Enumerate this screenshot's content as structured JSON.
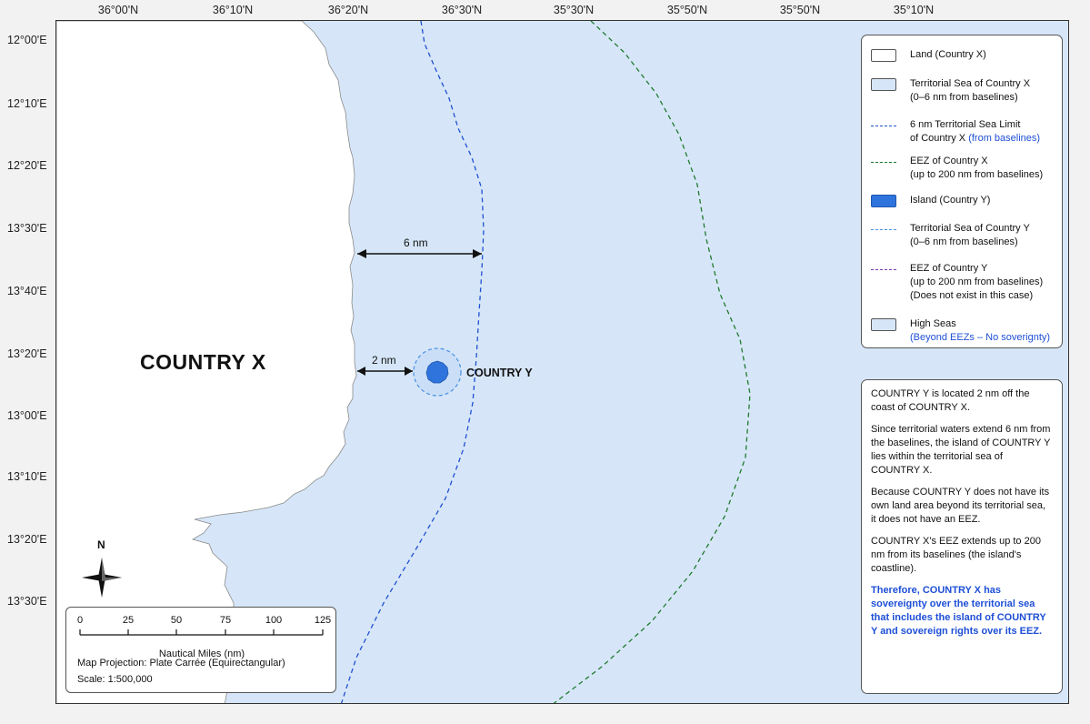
{
  "axes": {
    "top_labels": [
      "36°00'N",
      "36°10'N",
      "36°20'N",
      "36°30'N",
      "35°30'N",
      "35°50'N",
      "35°50'N",
      "35°10'N"
    ],
    "left_labels": [
      "12°00'E",
      "12°10'E",
      "12°20'E",
      "13°30'E",
      "13°40'E",
      "13°20'E",
      "13°00'E",
      "13°10'E",
      "13°20'E",
      "13°30'E"
    ]
  },
  "map": {
    "country_x_label": "COUNTRY X",
    "country_y_label": "COUNTRY Y",
    "six_nm_label": "6 nm",
    "two_nm_label": "2 nm",
    "north_label": "N"
  },
  "legend": {
    "items": [
      {
        "lines": [
          "Land (Country X)"
        ],
        "swatch": "land"
      },
      {
        "lines": [
          "Territorial Sea of Country X",
          "(0–6 nm from baselines)"
        ],
        "swatch": "sea"
      },
      {
        "lines": [
          "6 nm Territorial Sea Limit",
          "of Country X"
        ],
        "extra": "(from baselines)",
        "swatch": "dash-blue"
      },
      {
        "lines": [
          "EEZ of Country X",
          "(up to 200 nm from baselines)"
        ],
        "swatch": "dash-green"
      },
      {
        "lines": [
          "Island (Country Y)"
        ],
        "swatch": "island"
      },
      {
        "lines": [
          "Territorial Sea of Country Y",
          "(0–6 nm from baselines)"
        ],
        "swatch": "dash-lightblue"
      },
      {
        "lines": [
          "EEZ of Country Y",
          "(up to 200 nm from baselines)",
          "(Does not exist in this case)"
        ],
        "swatch": "dash-purple"
      },
      {
        "lines": [
          "High Seas"
        ],
        "extra_line": "(Beyond EEZs – No soverignty)",
        "swatch": "sea"
      }
    ]
  },
  "notes": {
    "p1": "COUNTRY Y is located 2 nm off the coast of COUNTRY X.",
    "p2": "Since territorial waters extend 6 nm from the baselines, the island of COUNTRY Y lies within the territorial sea of COUNTRY X.",
    "p3": "Because COUNTRY Y does not have its own land area beyond its territorial sea, it does not have an EEZ.",
    "p4": "COUNTRY X's EEZ extends up to 200 nm from its baselines (the island's coastline).",
    "p5": "Therefore, COUNTRY X has sovereignty over the territorial sea that includes the island of COUNTRY Y and sovereign rights over its EEZ."
  },
  "scale": {
    "ticks": [
      "0",
      "25",
      "50",
      "75",
      "100",
      "125"
    ],
    "title": "Nautical Miles (nm)",
    "projection": "Map Projection: Plate Carrée (Equirectangular)",
    "scale_text": "Scale: 1:500,000"
  },
  "colors": {
    "land": "#ffffff",
    "sea": "#d6e6f8",
    "limit_6nm": "#1f4fd1",
    "eez_x": "#1f7a2e",
    "island": "#2f74dc",
    "island_sea": "#4a90e2",
    "eez_y": "#7b3bb5",
    "accent_text": "#1e4fd6"
  }
}
